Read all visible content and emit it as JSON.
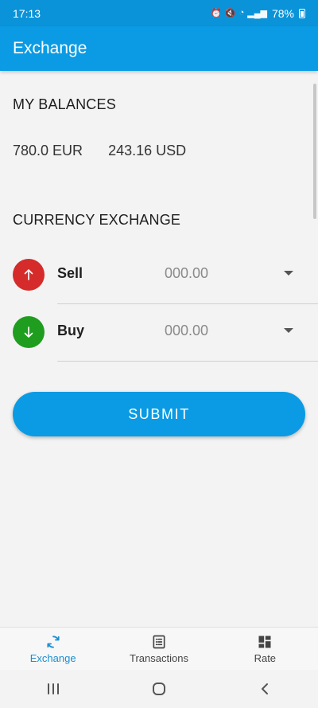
{
  "status_bar": {
    "time": "17:13",
    "battery": "78%"
  },
  "app_bar": {
    "title": "Exchange"
  },
  "balances": {
    "title": "MY BALANCES",
    "items": [
      "780.0 EUR",
      "243.16 USD"
    ]
  },
  "exchange": {
    "title": "CURRENCY EXCHANGE",
    "sell": {
      "label": "Sell",
      "value": "000.00"
    },
    "buy": {
      "label": "Buy",
      "value": "000.00"
    }
  },
  "submit": {
    "label": "SUBMIT"
  },
  "bottom_nav": {
    "items": [
      {
        "label": "Exchange",
        "icon": "sync-icon"
      },
      {
        "label": "Transactions",
        "icon": "list-icon"
      },
      {
        "label": "Rate",
        "icon": "dashboard-icon"
      }
    ]
  },
  "colors": {
    "accent": "#0a9be4",
    "sell": "#d52b2b",
    "buy": "#1f9d1f"
  }
}
